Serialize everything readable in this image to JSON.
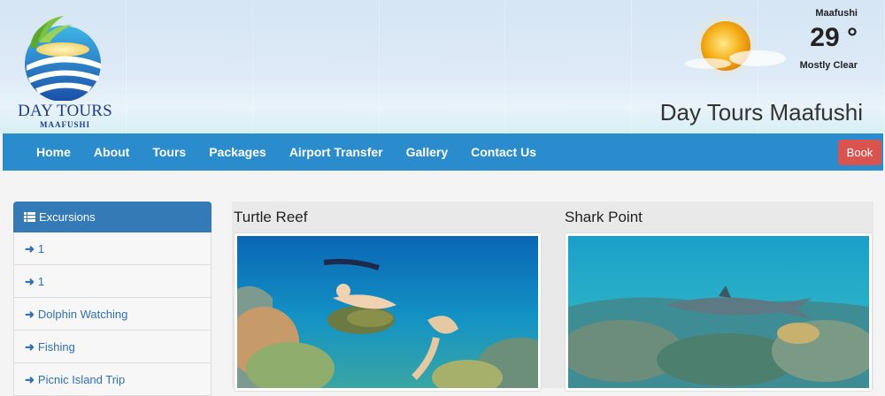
{
  "header": {
    "logo_text": "DAY TOURS",
    "logo_sub": "MAAFUSHI",
    "site_title": "Day Tours Maafushi"
  },
  "weather": {
    "location": "Maafushi",
    "temperature": "29 °",
    "condition": "Mostly Clear",
    "icon": "sun-cloud-icon"
  },
  "nav": {
    "items": [
      "Home",
      "About",
      "Tours",
      "Packages",
      "Airport Transfer",
      "Gallery",
      "Contact Us"
    ],
    "book_label": "Book"
  },
  "sidebar": {
    "heading": "Excursions",
    "items": [
      "1",
      "1",
      "Dolphin Watching",
      "Fishing",
      "Picnic Island Trip"
    ]
  },
  "cards": [
    {
      "title": "Turtle Reef"
    },
    {
      "title": "Shark Point"
    }
  ],
  "colors": {
    "nav_bg": "#2a8ccc",
    "book_btn": "#d9534f",
    "sidebar_head": "#337ab7",
    "link": "#2d70b4"
  }
}
